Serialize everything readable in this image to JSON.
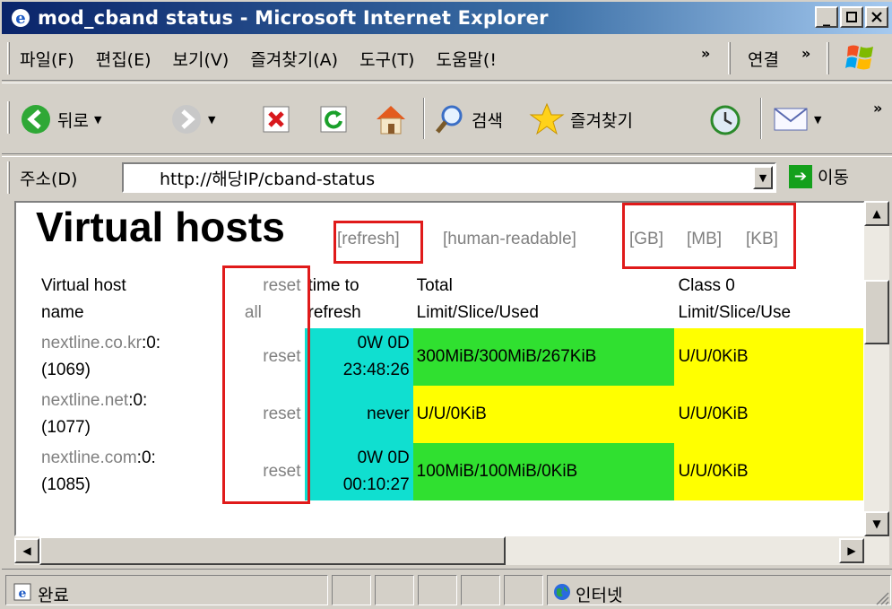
{
  "window": {
    "title": "mod_cband status - Microsoft Internet Explorer",
    "buttons": [
      "_",
      "□",
      "X"
    ]
  },
  "menu": {
    "items": [
      "파일(F)",
      "편집(E)",
      "보기(V)",
      "즐겨찾기(A)",
      "도구(T)",
      "도움말(!"
    ],
    "links_label": "연결"
  },
  "toolbar": {
    "back_label": "뒤로",
    "search_label": "검색",
    "favorites_label": "즐겨찾기"
  },
  "address": {
    "label": "주소(D)",
    "url": "http://해당IP/cband-status",
    "go_label": "이동"
  },
  "page": {
    "heading": "Virtual hosts",
    "refresh_link": "[refresh]",
    "human_readable_link": "[human-readable]",
    "gb_link": "[GB]",
    "mb_link": "[MB]",
    "kb_link": "[KB]",
    "table": {
      "headers": {
        "name_1": "Virtual host",
        "name_2": "name",
        "reset_1": "reset",
        "reset_2": "all",
        "time_1": "time to",
        "time_2": "refresh",
        "total_1": "Total",
        "total_2": "Limit/Slice/Used",
        "class_1": "Class 0",
        "class_2": "Limit/Slice/Use"
      },
      "rows": [
        {
          "host": "nextline.co.kr",
          "suffix": ":0:",
          "id": "(1069)",
          "reset": "reset",
          "time_1": "0W 0D",
          "time_2": "23:48:26",
          "total": "300MiB/300MiB/267KiB",
          "class0": "U/U/0KiB"
        },
        {
          "host": "nextline.net",
          "suffix": ":0:",
          "id": "(1077)",
          "reset": "reset",
          "time_1": "never",
          "time_2": "",
          "total": "U/U/0KiB",
          "class0": "U/U/0KiB"
        },
        {
          "host": "nextline.com",
          "suffix": ":0:",
          "id": "(1085)",
          "reset": "reset",
          "time_1": "0W 0D",
          "time_2": "00:10:27",
          "total": "100MiB/100MiB/0KiB",
          "class0": "U/U/0KiB"
        }
      ]
    }
  },
  "status": {
    "text": "완료",
    "zone": "인터넷"
  },
  "colors": {
    "time_cell": "#10dfd0",
    "limit_ok": "#30e030",
    "unlimited": "#ffff00",
    "highlight": "#e01a1a"
  }
}
